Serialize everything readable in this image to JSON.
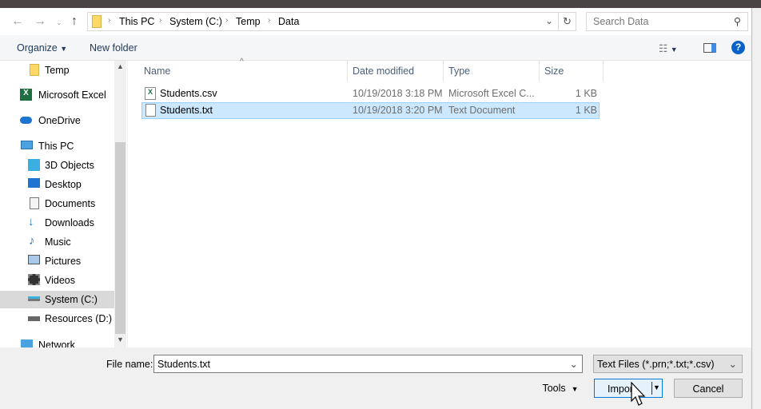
{
  "nav": {
    "breadcrumb": [
      "This PC",
      "System (C:)",
      "Temp",
      "Data"
    ],
    "search_placeholder": "Search Data"
  },
  "toolbar": {
    "organize": "Organize",
    "new_folder": "New folder"
  },
  "sidebar": {
    "items": [
      {
        "label": "Temp",
        "icon": "folder-icon"
      },
      {
        "label": "Microsoft Excel",
        "icon": "excel-icon"
      },
      {
        "label": "OneDrive",
        "icon": "cloud-icon"
      },
      {
        "label": "This PC",
        "icon": "computer-icon"
      },
      {
        "label": "3D Objects",
        "icon": "cube-icon"
      },
      {
        "label": "Desktop",
        "icon": "desktop-icon"
      },
      {
        "label": "Documents",
        "icon": "document-icon"
      },
      {
        "label": "Downloads",
        "icon": "download-icon"
      },
      {
        "label": "Music",
        "icon": "music-icon"
      },
      {
        "label": "Pictures",
        "icon": "pictures-icon"
      },
      {
        "label": "Videos",
        "icon": "video-icon"
      },
      {
        "label": "System (C:)",
        "icon": "drive-icon",
        "selected": true
      },
      {
        "label": "Resources (D:)",
        "icon": "drive-icon"
      },
      {
        "label": "Network",
        "icon": "network-icon"
      }
    ]
  },
  "list": {
    "columns": [
      "Name",
      "Date modified",
      "Type",
      "Size"
    ],
    "rows": [
      {
        "name": "Students.csv",
        "date": "10/19/2018 3:18 PM",
        "type": "Microsoft Excel C...",
        "size": "1 KB",
        "icon": "csv-file-icon"
      },
      {
        "name": "Students.txt",
        "date": "10/19/2018 3:20 PM",
        "type": "Text Document",
        "size": "1 KB",
        "icon": "text-file-icon",
        "selected": true
      }
    ]
  },
  "footer": {
    "file_name_label": "File name:",
    "file_name_value": "Students.txt",
    "file_type": "Text Files (*.prn;*.txt;*.csv)",
    "tools": "Tools",
    "import": "Import",
    "cancel": "Cancel"
  }
}
